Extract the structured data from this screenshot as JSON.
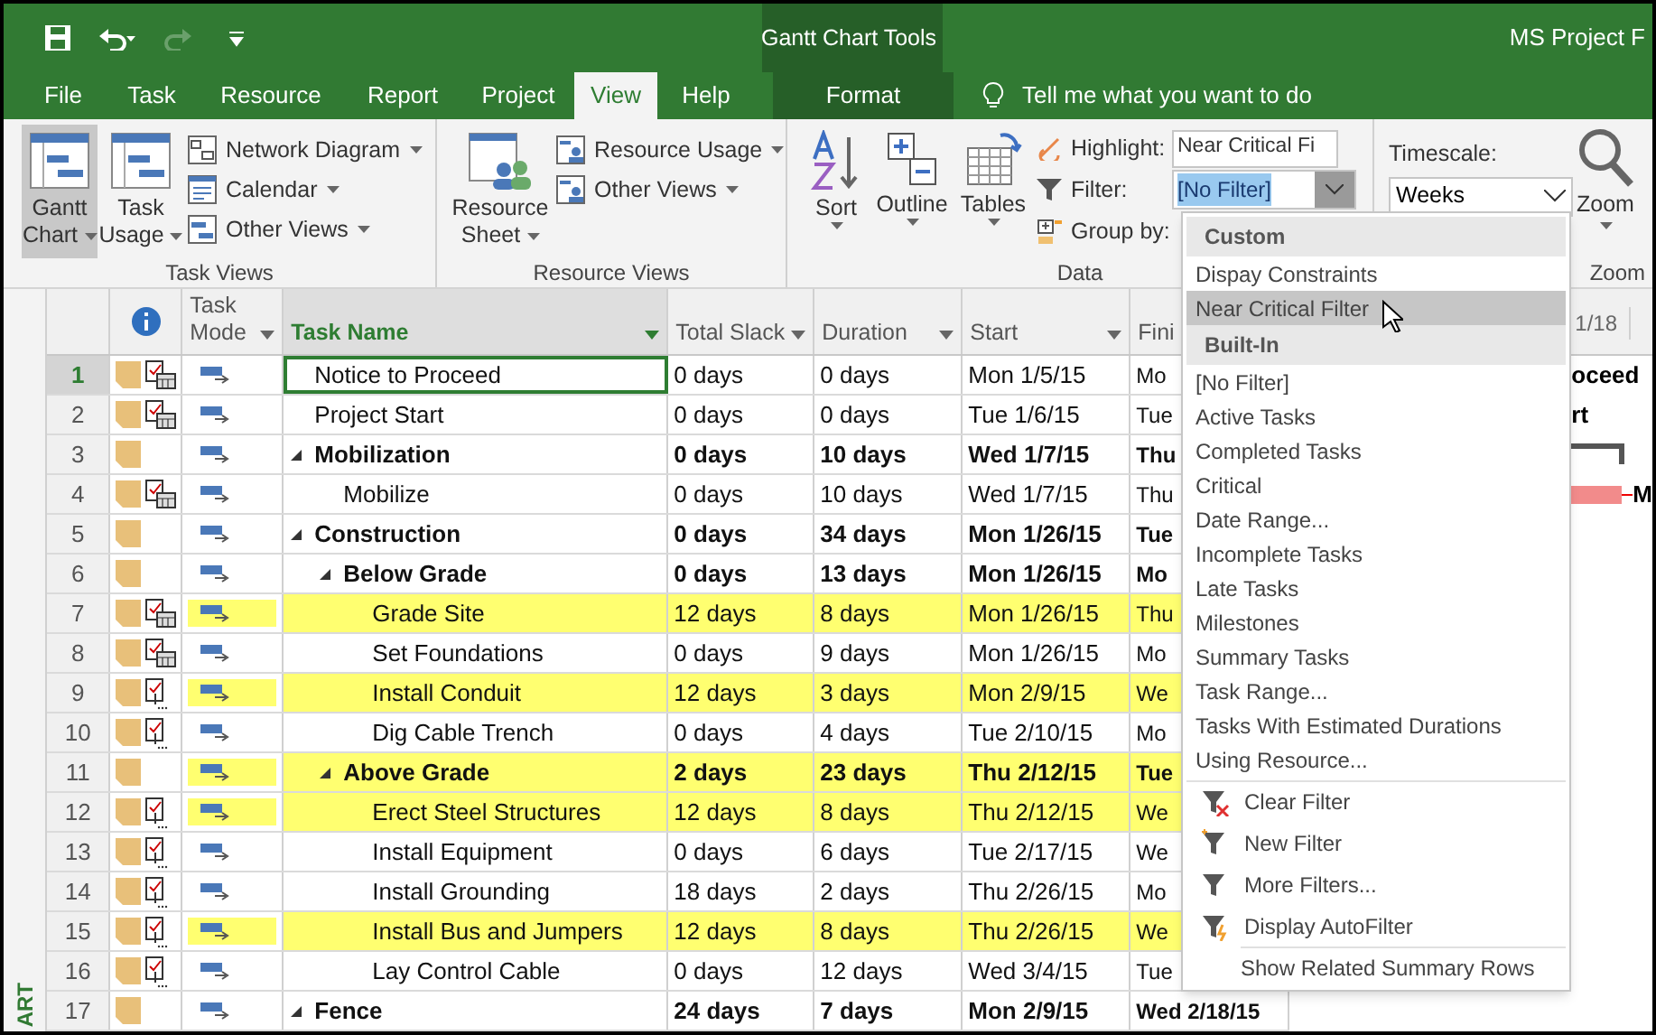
{
  "title_bar": {
    "context_title": "Gantt Chart Tools",
    "title": "MS Project F"
  },
  "tabs": [
    {
      "label": "File",
      "selected": false,
      "kind": "normal"
    },
    {
      "label": "Task",
      "selected": false,
      "kind": "normal"
    },
    {
      "label": "Resource",
      "selected": false,
      "kind": "normal"
    },
    {
      "label": "Report",
      "selected": false,
      "kind": "normal"
    },
    {
      "label": "Project",
      "selected": false,
      "kind": "normal"
    },
    {
      "label": "View",
      "selected": true,
      "kind": "normal"
    },
    {
      "label": "Help",
      "selected": false,
      "kind": "normal"
    },
    {
      "label": "Format",
      "selected": false,
      "kind": "context"
    }
  ],
  "tell_me": {
    "placeholder": "Tell me what you want to do"
  },
  "ribbon": {
    "task_views": {
      "label": "Task Views",
      "large": [
        {
          "lines": [
            "Gantt",
            "Chart"
          ],
          "selected": true
        },
        {
          "lines": [
            "Task",
            "Usage"
          ],
          "selected": false
        }
      ],
      "small": [
        {
          "label": "Network Diagram"
        },
        {
          "label": "Calendar"
        },
        {
          "label": "Other Views"
        }
      ]
    },
    "resource_views": {
      "label": "Resource Views",
      "large": [
        {
          "lines": [
            "Resource",
            "Sheet"
          ],
          "selected": false
        }
      ],
      "small": [
        {
          "label": "Resource Usage"
        },
        {
          "label": "Other Views"
        }
      ]
    },
    "data": {
      "label": "Data",
      "large": [
        {
          "lines": [
            "Sort"
          ]
        },
        {
          "lines": [
            "Outline"
          ]
        },
        {
          "lines": [
            "Tables"
          ]
        }
      ],
      "highlight": {
        "label": "Highlight:",
        "value": "Near Critical Fi"
      },
      "filter": {
        "label": "Filter:",
        "value": "[No Filter]",
        "open": true
      },
      "group_by": {
        "label": "Group by:"
      }
    },
    "zoom": {
      "label": "Zoom",
      "timescale": {
        "label": "Timescale:",
        "value": "Weeks"
      },
      "button": "Zoom"
    }
  },
  "table": {
    "columns": [
      {
        "label": "Task Mode",
        "selected": false
      },
      {
        "label": "Task Name",
        "selected": true
      },
      {
        "label": "Total Slack",
        "selected": false
      },
      {
        "label": "Duration",
        "selected": false
      },
      {
        "label": "Start",
        "selected": false
      },
      {
        "label": "Fini",
        "selected": false
      }
    ],
    "rows": [
      {
        "id": "1",
        "name": "Notice to Proceed",
        "kind": "constrained",
        "selected": true,
        "highlighted": false,
        "slack": "0 days",
        "duration": "0 days",
        "start": "Mon 1/5/15",
        "finish": "Mo",
        "gantt": {
          "kind": "text",
          "text": "oceed"
        }
      },
      {
        "id": "2",
        "name": "Project Start",
        "kind": "constrained",
        "selected": false,
        "highlighted": false,
        "slack": "0 days",
        "duration": "0 days",
        "start": "Tue 1/6/15",
        "finish": "Tue",
        "gantt": {
          "kind": "text",
          "text": "rt"
        }
      },
      {
        "id": "3",
        "name": "Mobilization",
        "kind": "summary",
        "expanded": true,
        "selected": false,
        "highlighted": false,
        "slack": "0 days",
        "duration": "10 days",
        "start": "Wed 1/7/15",
        "finish": "Thu",
        "gantt": {
          "kind": "summary"
        },
        "children": [
          {
            "id": "4",
            "name": "Mobilize",
            "kind": "constrained",
            "selected": false,
            "highlighted": false,
            "slack": "0 days",
            "duration": "10 days",
            "start": "Wed 1/7/15",
            "finish": "Thu",
            "gantt": {
              "kind": "bar",
              "text": "M"
            }
          }
        ]
      },
      {
        "id": "5",
        "name": "Construction",
        "kind": "summary",
        "expanded": true,
        "selected": false,
        "highlighted": false,
        "slack": "0 days",
        "duration": "34 days",
        "start": "Mon 1/26/15",
        "finish": "Tue",
        "children": [
          {
            "id": "6",
            "name": "Below Grade",
            "kind": "summary",
            "expanded": true,
            "selected": false,
            "highlighted": false,
            "slack": "0 days",
            "duration": "13 days",
            "start": "Mon 1/26/15",
            "finish": "Mo",
            "children": [
              {
                "id": "7",
                "name": "Grade Site",
                "kind": "constrained",
                "selected": false,
                "highlighted": true,
                "slack": "12 days",
                "duration": "8 days",
                "start": "Mon 1/26/15",
                "finish": "Thu"
              },
              {
                "id": "8",
                "name": "Set Foundations",
                "kind": "constrained",
                "selected": false,
                "highlighted": false,
                "slack": "0 days",
                "duration": "9 days",
                "start": "Mon 1/26/15",
                "finish": "Mo"
              },
              {
                "id": "9",
                "name": "Install Conduit",
                "kind": "checklist",
                "selected": false,
                "highlighted": true,
                "slack": "12 days",
                "duration": "3 days",
                "start": "Mon 2/9/15",
                "finish": "We"
              },
              {
                "id": "10",
                "name": "Dig Cable Trench",
                "kind": "checklist",
                "selected": false,
                "highlighted": false,
                "slack": "0 days",
                "duration": "4 days",
                "start": "Tue 2/10/15",
                "finish": "Mo"
              }
            ]
          },
          {
            "id": "11",
            "name": "Above Grade",
            "kind": "summary",
            "expanded": true,
            "selected": false,
            "highlighted": true,
            "slack": "2 days",
            "duration": "23 days",
            "start": "Thu 2/12/15",
            "finish": "Tue",
            "children": [
              {
                "id": "12",
                "name": "Erect Steel Structures",
                "kind": "checklist",
                "selected": false,
                "highlighted": true,
                "slack": "12 days",
                "duration": "8 days",
                "start": "Thu 2/12/15",
                "finish": "We"
              },
              {
                "id": "13",
                "name": "Install Equipment",
                "kind": "checklist",
                "selected": false,
                "highlighted": false,
                "slack": "0 days",
                "duration": "6 days",
                "start": "Tue 2/17/15",
                "finish": "We"
              },
              {
                "id": "14",
                "name": "Install Grounding",
                "kind": "checklist",
                "selected": false,
                "highlighted": false,
                "slack": "18 days",
                "duration": "2 days",
                "start": "Thu 2/26/15",
                "finish": "Mo"
              },
              {
                "id": "15",
                "name": "Install Bus and Jumpers",
                "kind": "checklist",
                "selected": false,
                "highlighted": true,
                "slack": "12 days",
                "duration": "8 days",
                "start": "Thu 2/26/15",
                "finish": "We"
              },
              {
                "id": "16",
                "name": "Lay Control Cable",
                "kind": "checklist",
                "selected": false,
                "highlighted": false,
                "slack": "0 days",
                "duration": "12 days",
                "start": "Wed 3/4/15",
                "finish": "Tue"
              }
            ]
          }
        ]
      },
      {
        "id": "17",
        "name": "Fence",
        "kind": "summary",
        "expanded": true,
        "selected": false,
        "highlighted": false,
        "slack": "24 days",
        "duration": "7 days",
        "start": "Mon 2/9/15",
        "finish": "Wed 2/18/15"
      }
    ]
  },
  "gantt": {
    "timescale_label": "1/18",
    "side_label": "ART"
  },
  "filter_menu": [
    {
      "kind": "header",
      "label": "Custom"
    },
    {
      "kind": "item",
      "label": "Dispay Constraints",
      "selected": false
    },
    {
      "kind": "item",
      "label": "Near Critical Filter",
      "selected": true
    },
    {
      "kind": "header",
      "label": "Built-In"
    },
    {
      "kind": "item",
      "label": "[No Filter]",
      "selected": false
    },
    {
      "kind": "item",
      "label": "Active Tasks",
      "selected": false
    },
    {
      "kind": "item",
      "label": "Completed Tasks",
      "selected": false
    },
    {
      "kind": "item",
      "label": "Critical",
      "selected": false
    },
    {
      "kind": "item",
      "label": "Date Range...",
      "selected": false
    },
    {
      "kind": "item",
      "label": "Incomplete Tasks",
      "selected": false
    },
    {
      "kind": "item",
      "label": "Late Tasks",
      "selected": false
    },
    {
      "kind": "item",
      "label": "Milestones",
      "selected": false
    },
    {
      "kind": "item",
      "label": "Summary Tasks",
      "selected": false
    },
    {
      "kind": "item",
      "label": "Task Range...",
      "selected": false
    },
    {
      "kind": "item",
      "label": "Tasks With Estimated Durations",
      "selected": false
    },
    {
      "kind": "item",
      "label": "Using Resource...",
      "selected": false
    },
    {
      "kind": "action",
      "label": "Clear Filter"
    },
    {
      "kind": "action",
      "label": "New Filter"
    },
    {
      "kind": "action",
      "label": "More Filters..."
    },
    {
      "kind": "action",
      "label": "Display AutoFilter"
    },
    {
      "kind": "option",
      "label": "Show Related Summary Rows"
    }
  ]
}
